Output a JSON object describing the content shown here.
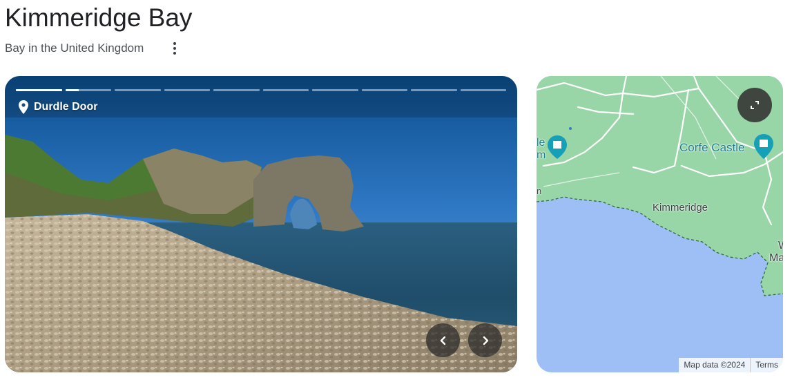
{
  "header": {
    "title": "Kimmeridge Bay",
    "subtitle": "Bay in the United Kingdom",
    "more_icon": "more-vert-icon"
  },
  "photo": {
    "location_label": "Durdle Door",
    "location_icon": "location-pin-icon",
    "prev_icon": "chevron-left-icon",
    "next_icon": "chevron-right-icon",
    "progress": [
      1,
      0.3,
      0,
      0,
      0,
      0,
      0,
      0,
      0,
      0
    ]
  },
  "map": {
    "labels": {
      "corfe_castle": "Corfe Castle",
      "kimmeridge": "Kimmeridge",
      "left_edge_1": "le",
      "left_edge_2": "m",
      "right_edge_1": "W",
      "right_edge_2": "Ma",
      "left_edge_3": "n"
    },
    "attribution": "Map data ©2024",
    "terms": "Terms",
    "expand_icon": "fullscreen-icon",
    "colors": {
      "land": "#98d6a8",
      "water": "#9ebff5",
      "roads": "#ffffff",
      "poi": "#16a0b8"
    }
  }
}
